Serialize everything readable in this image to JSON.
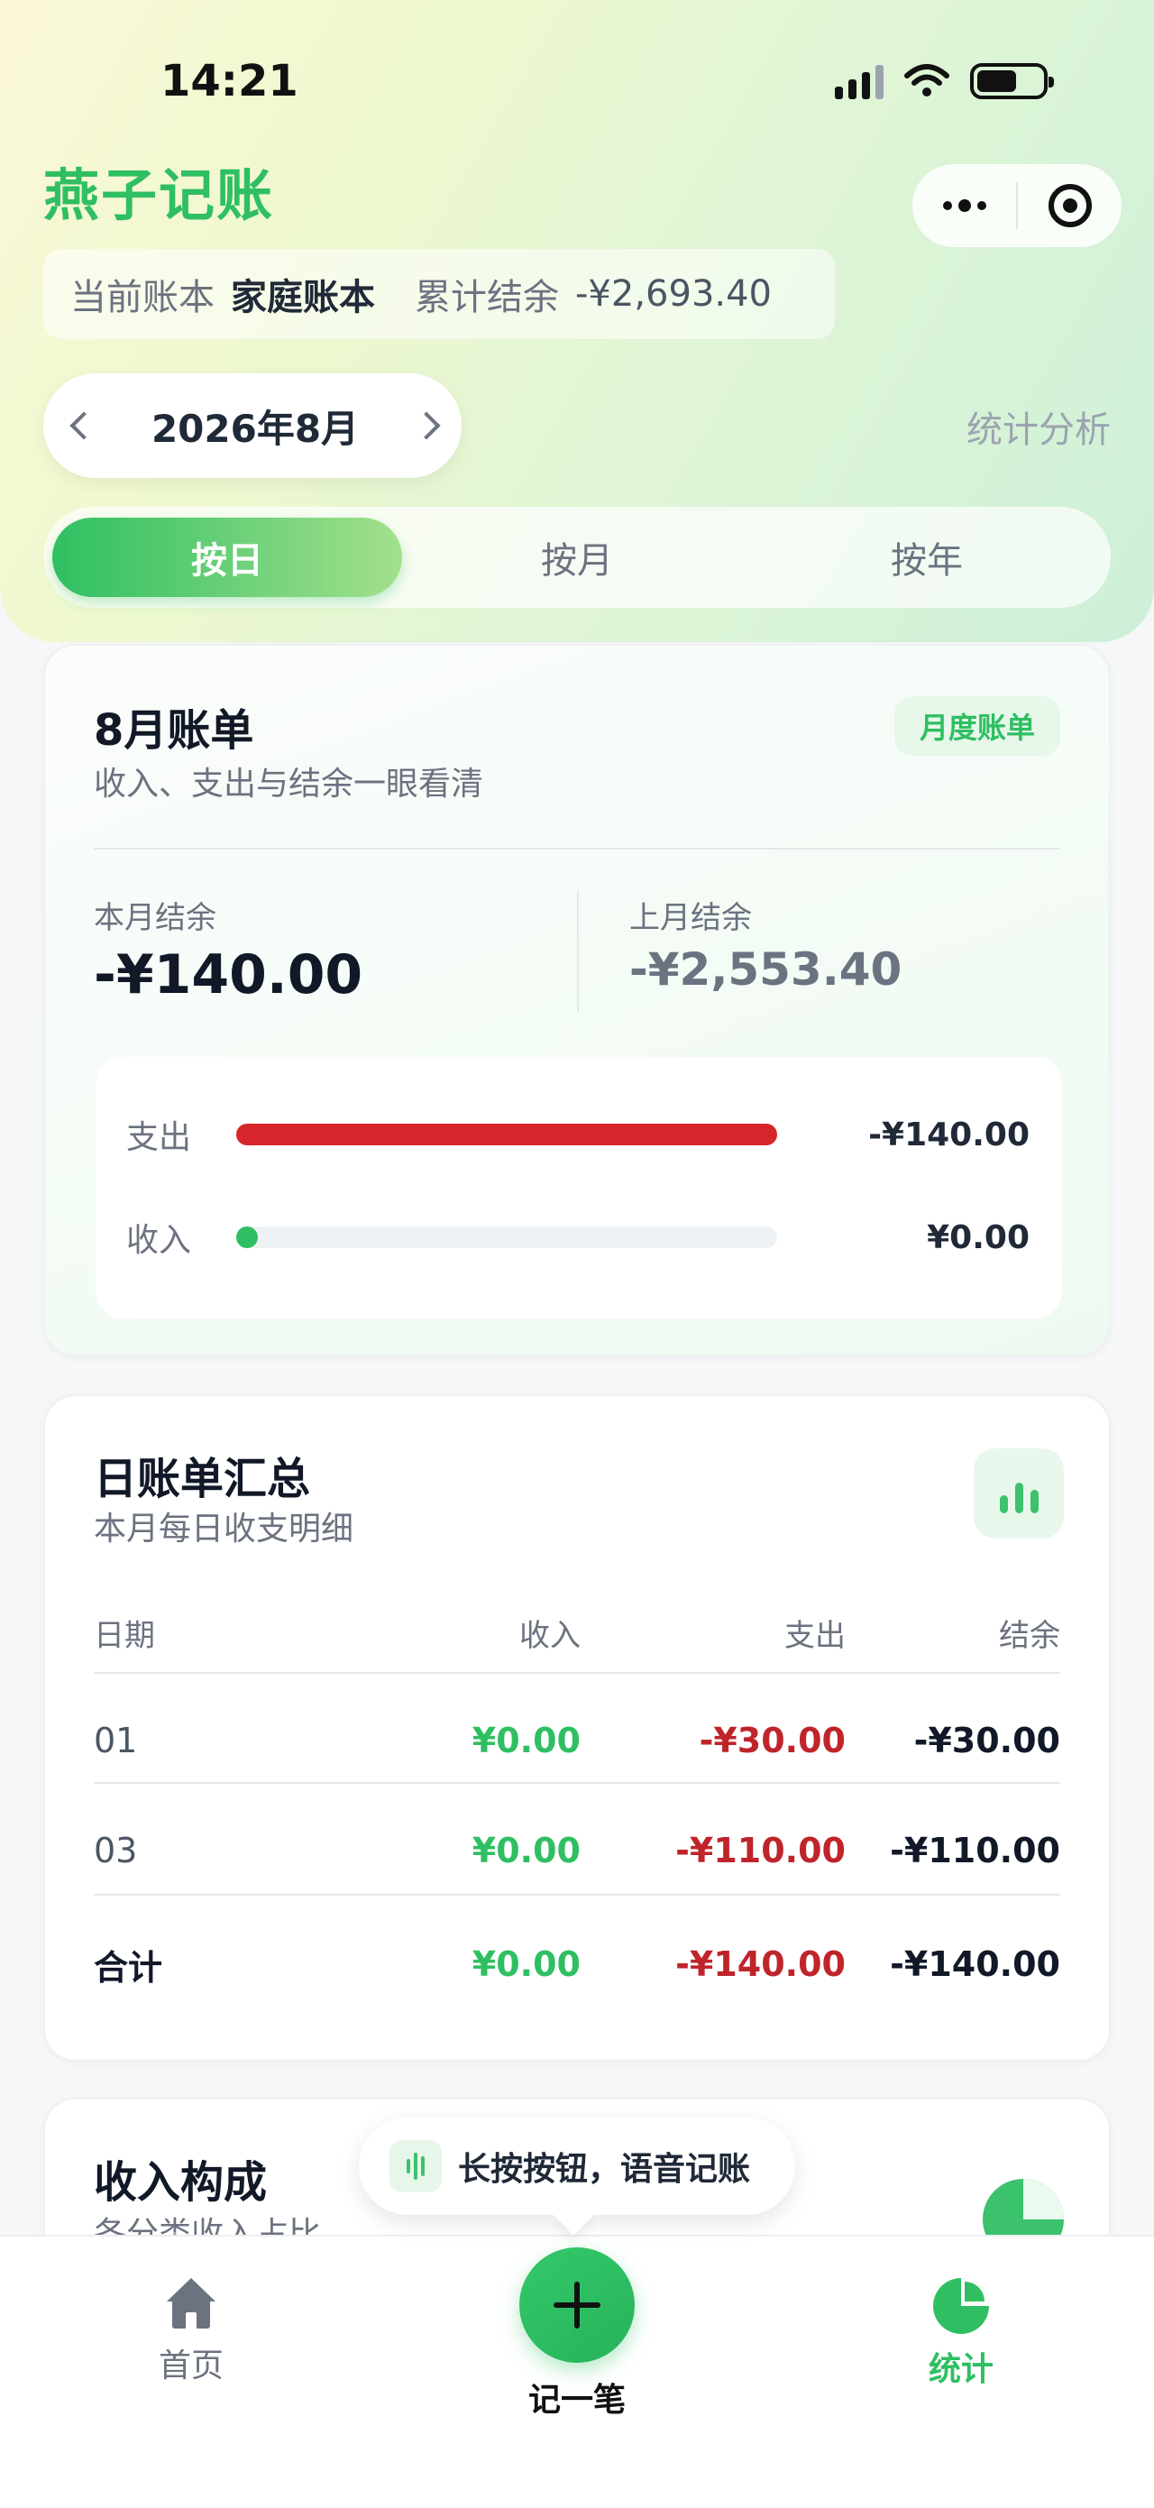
{
  "status_bar": {
    "time": "14:21"
  },
  "header": {
    "app_title": "燕子记账",
    "book_label": "当前账本",
    "book_name": "家庭账本",
    "total_label": "累计结余",
    "total_value": "-¥2,693.40",
    "month": "2026年8月",
    "stats_link": "统计分析"
  },
  "segment": {
    "tabs": [
      {
        "label": "按日",
        "active": true
      },
      {
        "label": "按月",
        "active": false
      },
      {
        "label": "按年",
        "active": false
      }
    ]
  },
  "monthly_card": {
    "title": "8月账单",
    "subtitle": "收入、支出与结余一眼看清",
    "badge": "月度账单",
    "this_month_label": "本月结余",
    "this_month_value": "-¥140.00",
    "last_month_label": "上月结余",
    "last_month_value": "-¥2,553.40",
    "expense_label": "支出",
    "expense_value": "-¥140.00",
    "expense_fraction": 1.0,
    "income_label": "收入",
    "income_value": "¥0.00",
    "income_fraction": 0.0
  },
  "daily_card": {
    "title": "日账单汇总",
    "subtitle": "本月每日收支明细",
    "columns": [
      "日期",
      "收入",
      "支出",
      "结余"
    ],
    "rows": [
      {
        "date": "01",
        "income": "¥0.00",
        "expense": "-¥30.00",
        "balance": "-¥30.00"
      },
      {
        "date": "03",
        "income": "¥0.00",
        "expense": "-¥110.00",
        "balance": "-¥110.00"
      }
    ],
    "total": {
      "label": "合计",
      "income": "¥0.00",
      "expense": "-¥140.00",
      "balance": "-¥140.00"
    }
  },
  "income_card": {
    "title": "收入构成",
    "subtitle": "各分类收入占比"
  },
  "tooltip": {
    "text": "长按按钮，语音记账"
  },
  "tabbar": {
    "home": "首页",
    "add": "记一笔",
    "stats": "统计"
  },
  "colors": {
    "accent": "#2fbf62",
    "expense": "#d7262b",
    "negative_text": "#c0242b"
  }
}
